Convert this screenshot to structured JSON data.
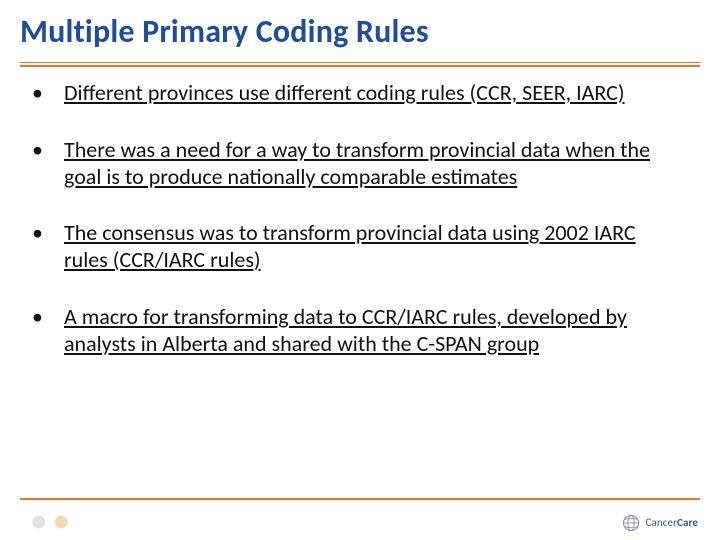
{
  "slide": {
    "title": "Multiple Primary Coding Rules",
    "bullets": [
      "Different provinces use different coding rules (CCR, SEER, IARC)",
      "There was a need for a way to transform provincial data when the goal is to produce nationally comparable estimates",
      "The consensus was to transform provincial  data using 2002 IARC rules (CCR/IARC rules)",
      "A macro for transforming data to CCR/IARC rules, developed by analysts in Alberta and shared with the C-SPAN group"
    ]
  },
  "footer": {
    "right_brand": "CancerCare",
    "right_sub": ""
  }
}
